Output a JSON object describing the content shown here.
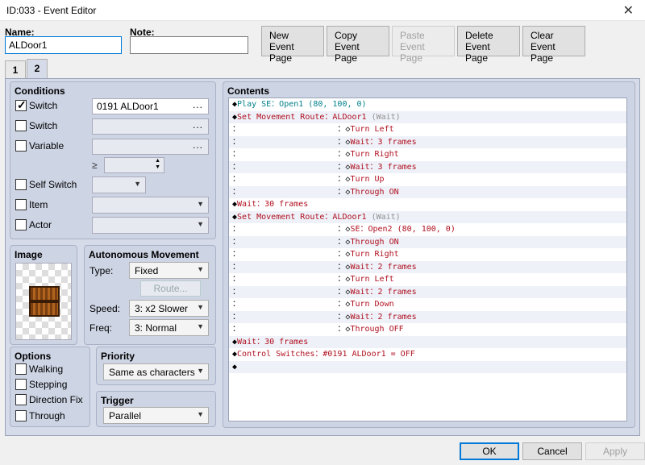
{
  "window": {
    "title": "ID:033 - Event Editor",
    "close": "✕"
  },
  "name": {
    "label": "Name:",
    "value": "ALDoor1"
  },
  "note": {
    "label": "Note:",
    "value": ""
  },
  "toolbar": {
    "new": [
      "New",
      "Event Page"
    ],
    "copy": [
      "Copy",
      "Event Page"
    ],
    "paste": [
      "Paste",
      "Event Page"
    ],
    "delete": [
      "Delete",
      "Event Page"
    ],
    "clear": [
      "Clear",
      "Event Page"
    ]
  },
  "tabs": [
    "1",
    "2"
  ],
  "conditions": {
    "title": "Conditions",
    "switch1": {
      "label": "Switch",
      "checked": true,
      "value": "0191 ALDoor1"
    },
    "switch2": {
      "label": "Switch",
      "checked": false,
      "value": ""
    },
    "variable": {
      "label": "Variable",
      "checked": false,
      "value": "",
      "ge": "≥"
    },
    "self_switch": {
      "label": "Self Switch",
      "checked": false
    },
    "item": {
      "label": "Item",
      "checked": false
    },
    "actor": {
      "label": "Actor",
      "checked": false
    },
    "dots": "..."
  },
  "image": {
    "title": "Image"
  },
  "autonomous": {
    "title": "Autonomous Movement",
    "type_label": "Type:",
    "type_value": "Fixed",
    "route_button": "Route...",
    "speed_label": "Speed:",
    "speed_value": "3: x2 Slower",
    "freq_label": "Freq:",
    "freq_value": "3: Normal"
  },
  "options": {
    "title": "Options",
    "walking": "Walking",
    "stepping": "Stepping",
    "direction_fix": "Direction Fix",
    "through": "Through"
  },
  "priority": {
    "title": "Priority",
    "value": "Same as characters"
  },
  "trigger": {
    "title": "Trigger",
    "value": "Parallel"
  },
  "contents": {
    "title": "Contents",
    "rows": [
      {
        "pre": "◆",
        "text": "Play SE：Open1 (80, 100, 0)",
        "color": "teal"
      },
      {
        "pre": "◆",
        "text": "Set Movement Route：ALDoor1 ",
        "color": "red",
        "suffix": "(Wait)"
      },
      {
        "pre": "：                    ：◇",
        "text": "Turn Left",
        "color": "red"
      },
      {
        "pre": "：                    ：◇",
        "text": "Wait：3 frames",
        "color": "red"
      },
      {
        "pre": "：                    ：◇",
        "text": "Turn Right",
        "color": "red"
      },
      {
        "pre": "：                    ：◇",
        "text": "Wait：3 frames",
        "color": "red"
      },
      {
        "pre": "：                    ：◇",
        "text": "Turn Up",
        "color": "red"
      },
      {
        "pre": "：                    ：◇",
        "text": "Through ON",
        "color": "red"
      },
      {
        "pre": "◆",
        "text": "Wait：30 frames",
        "color": "red"
      },
      {
        "pre": "◆",
        "text": "Set Movement Route：ALDoor1 ",
        "color": "red",
        "suffix": "(Wait)"
      },
      {
        "pre": "：                    ：◇",
        "text": "SE：Open2 (80, 100, 0)",
        "color": "red"
      },
      {
        "pre": "：                    ：◇",
        "text": "Through ON",
        "color": "red"
      },
      {
        "pre": "：                    ：◇",
        "text": "Turn Right",
        "color": "red"
      },
      {
        "pre": "：                    ：◇",
        "text": "Wait：2 frames",
        "color": "red"
      },
      {
        "pre": "：                    ：◇",
        "text": "Turn Left",
        "color": "red"
      },
      {
        "pre": "：                    ：◇",
        "text": "Wait：2 frames",
        "color": "red"
      },
      {
        "pre": "：                    ：◇",
        "text": "Turn Down",
        "color": "red"
      },
      {
        "pre": "：                    ：◇",
        "text": "Wait：2 frames",
        "color": "red"
      },
      {
        "pre": "：                    ：◇",
        "text": "Through OFF",
        "color": "red"
      },
      {
        "pre": "◆",
        "text": "Wait：30 frames",
        "color": "red"
      },
      {
        "pre": "◆",
        "text": "Control Switches：#0191 ALDoor1 = OFF",
        "color": "red"
      },
      {
        "pre": "◆",
        "text": "",
        "color": "black"
      }
    ]
  },
  "footer": {
    "ok": "OK",
    "cancel": "Cancel",
    "apply": "Apply"
  }
}
